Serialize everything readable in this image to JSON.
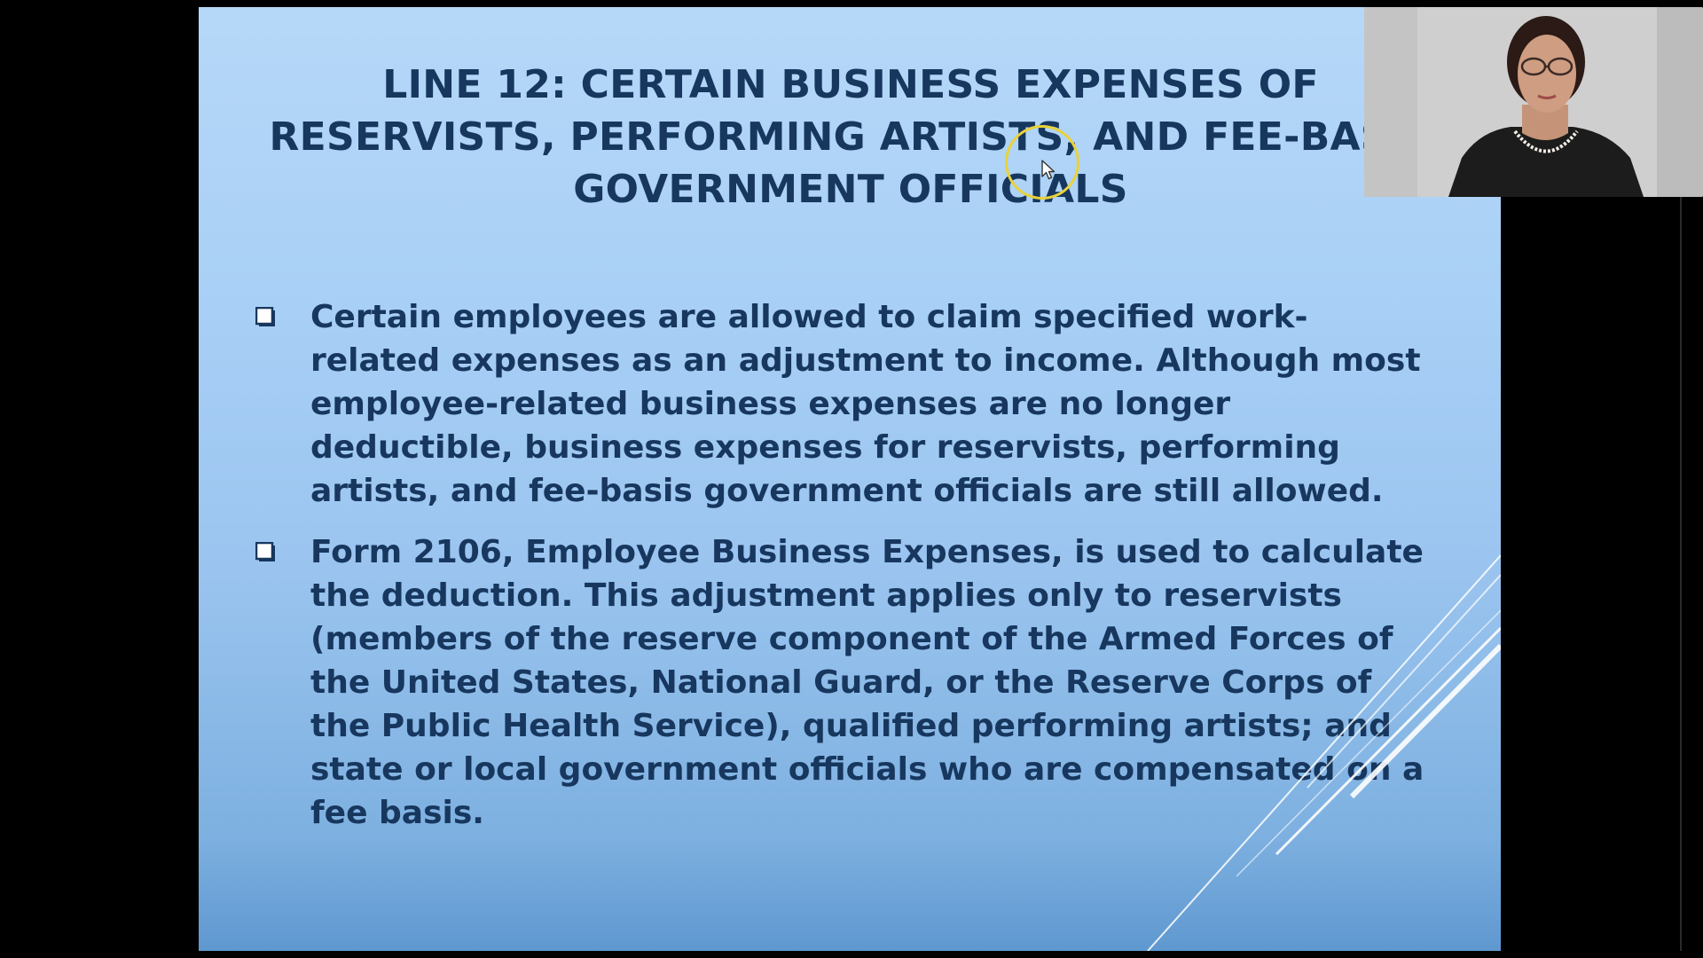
{
  "slide": {
    "title": "LINE 12: CERTAIN BUSINESS EXPENSES OF RESERVISTS, PERFORMING ARTISTS, AND FEE-BASIS GOVERNMENT OFFICIALS",
    "bullets": [
      {
        "text": "Certain employees are allowed to claim specified work-related expenses as an adjustment to income. Although most employee-related business expenses are no longer deductible, business expenses for reservists, performing artists, and fee-basis government officials are still allowed.",
        "icon": "checkbox-icon"
      },
      {
        "text": "Form 2106, Employee Business Expenses, is used to calculate the deduction. This adjustment applies only to reservists (members of the reserve component of the Armed Forces of the United States, National Guard, or the Reserve Corps of the Public Health Service), qualified performing artists; and state or local government officials who are compensated on a fee basis.",
        "icon": "checkbox-icon"
      }
    ]
  },
  "colors": {
    "text": "#17375e",
    "slide_top": "#b6d8f8",
    "slide_bottom": "#5f98d0",
    "cursor_ring": "#e8d23a"
  },
  "webcam": {
    "icon": "presenter-video"
  }
}
